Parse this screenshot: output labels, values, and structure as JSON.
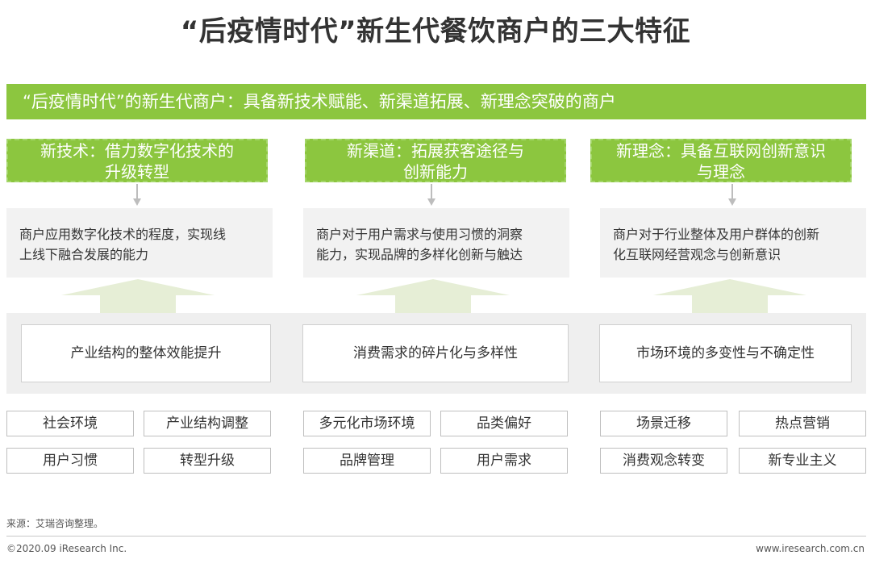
{
  "title": "“后疫情时代”新生代餐饮商户的三大特征",
  "banner": "“后疫情时代”的新生代商户：具备新技术赋能、新渠道拓展、新理念突破的商户",
  "columns": [
    {
      "header_line1": "新技术：借力数字化技术的",
      "header_line2": "升级转型",
      "desc_line1": "商户应用数字化技术的程度，实现线",
      "desc_line2": "上线下融合发展的能力",
      "factor": "产业结构的整体效能提升",
      "tags": [
        "社会环境",
        "产业结构调整",
        "用户习惯",
        "转型升级"
      ]
    },
    {
      "header_line1": "新渠道：拓展获客途径与",
      "header_line2": "创新能力",
      "desc_line1": "商户对于用户需求与使用习惯的洞察",
      "desc_line2": "能力，实现品牌的多样化创新与触达",
      "factor": "消费需求的碎片化与多样性",
      "tags": [
        "多元化市场环境",
        "品类偏好",
        "品牌管理",
        "用户需求"
      ]
    },
    {
      "header_line1": "新理念：具备互联网创新意识",
      "header_line2": "与理念",
      "desc_line1": "商户对于行业整体及用户群体的创新",
      "desc_line2": "化互联网经营观念与创新意识",
      "factor": "市场环境的多变性与不确定性",
      "tags": [
        "场景迁移",
        "热点营销",
        "消费观念转变",
        "新专业主义"
      ]
    }
  ],
  "source": "来源：艾瑞咨询整理。",
  "copyright": "©2020.09 iResearch Inc.",
  "website": "www.iresearch.com.cn",
  "colors": {
    "accent_green": "#8cc63f",
    "arrow_tint": "#e6eed6",
    "panel_gray": "#f2f2f2"
  }
}
